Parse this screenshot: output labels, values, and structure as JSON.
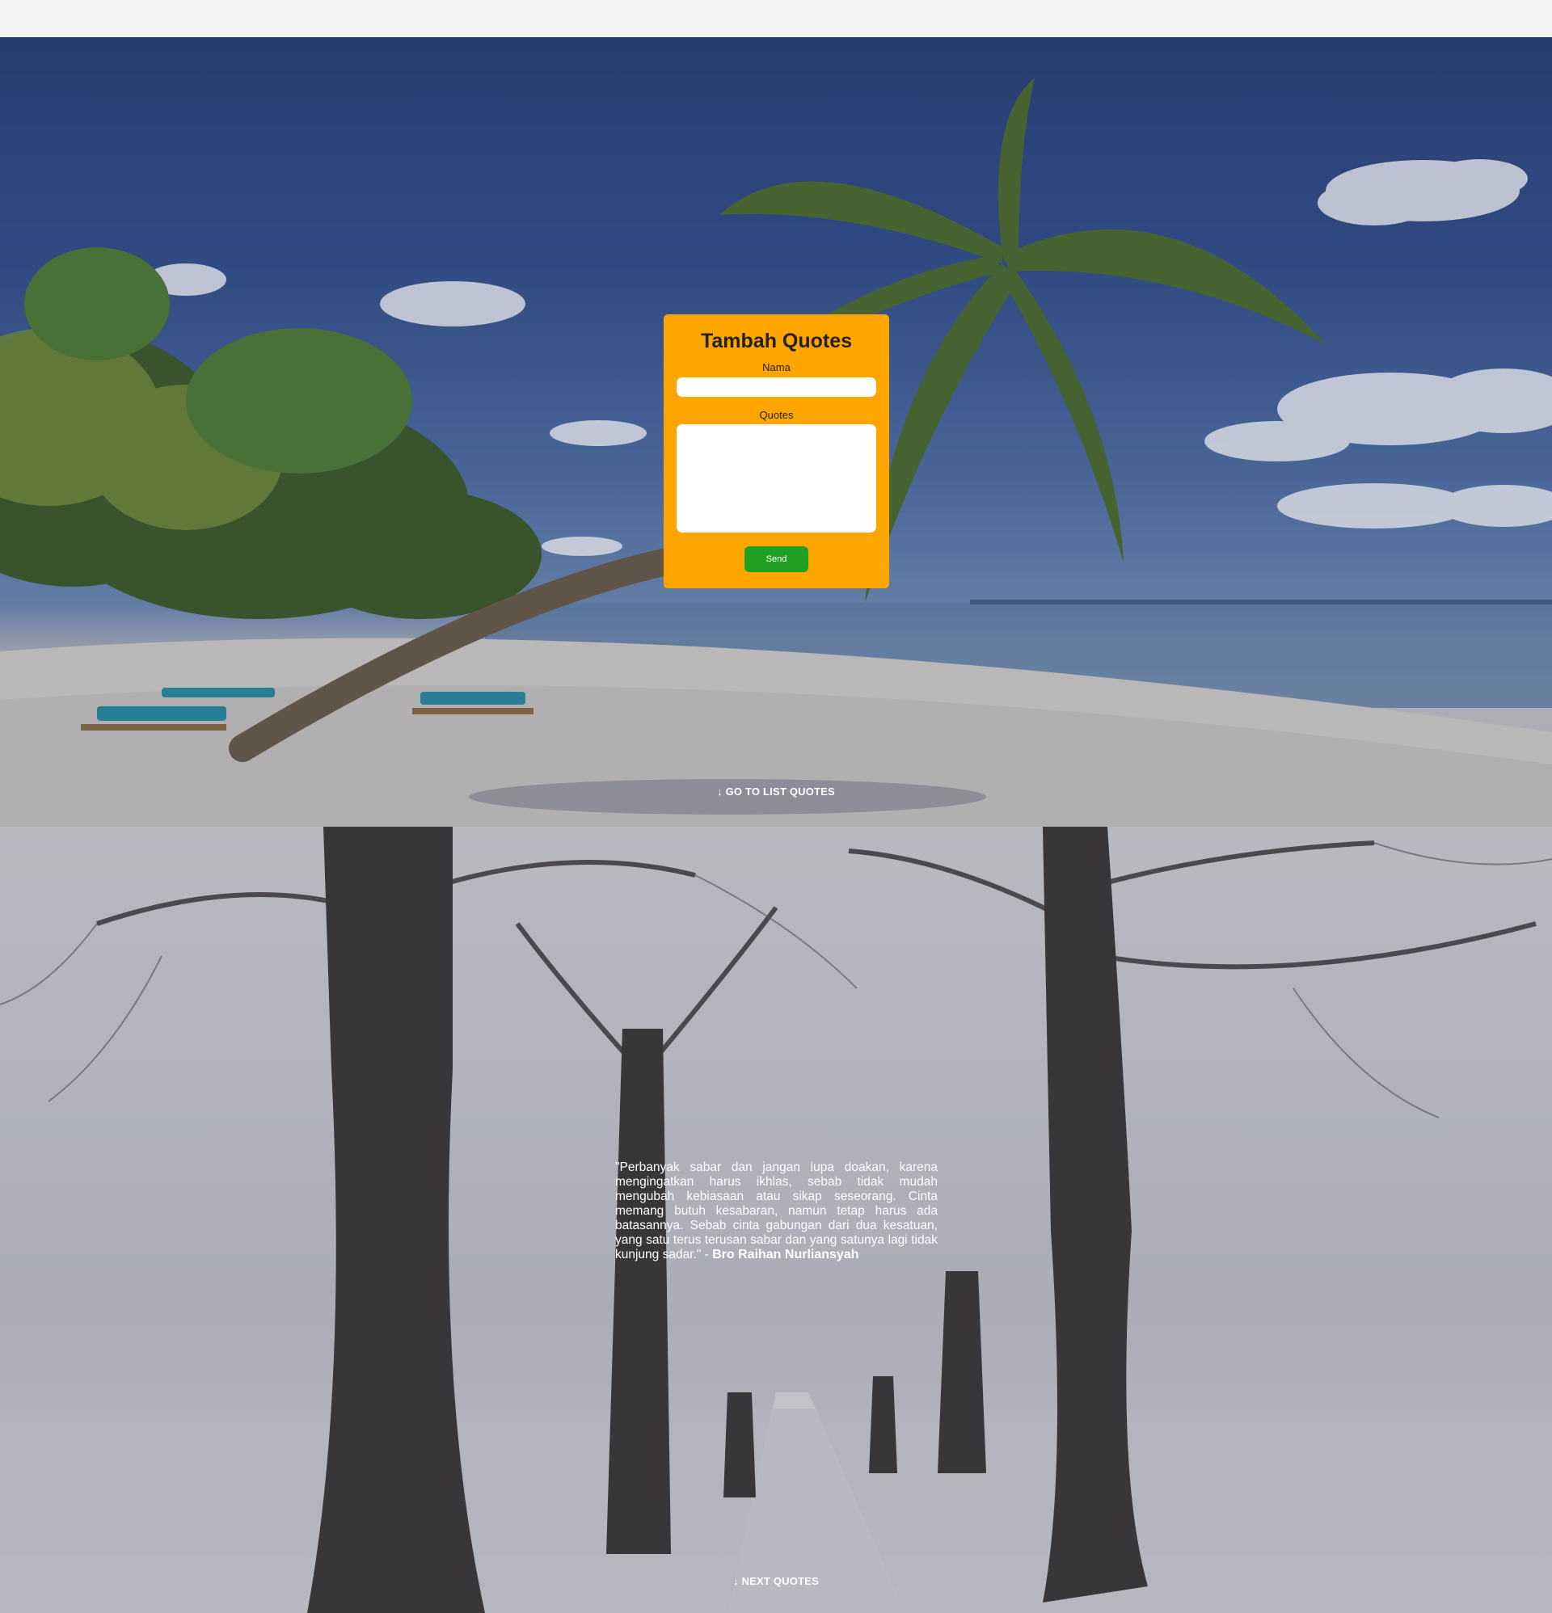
{
  "form": {
    "title": "Tambah Quotes",
    "nama_label": "Nama",
    "nama_value": "",
    "quotes_label": "Quotes",
    "quotes_value": "",
    "send_label": "Send",
    "accent_color": "#ffa500",
    "send_color": "#20a020"
  },
  "nav": {
    "go_to_list": "↓ GO TO LIST QUOTES",
    "next_quotes": "↓ NEXT QUOTES"
  },
  "quote": {
    "text": "\"Perbanyak sabar dan jangan lupa doakan, karena mengingatkan harus ikhlas, sebab tidak mudah mengubah kebiasaan atau sikap seseorang. Cinta memang butuh kesabaran, namun tetap harus ada batasannya. Sebab cinta gabungan dari dua kesatuan, yang satu terus terusan sabar dan yang satunya lagi tidak kunjung sadar.\" - ",
    "author": "Bro Raihan Nurliansyah"
  }
}
